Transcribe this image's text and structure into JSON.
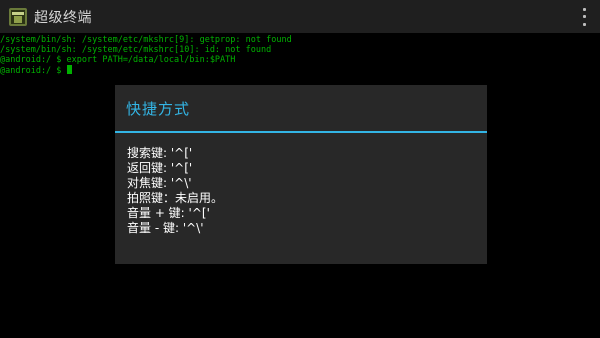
{
  "app": {
    "title": "超级终端",
    "icon": "terminal-app-icon",
    "overflow_icon": "overflow-menu-icon"
  },
  "terminal": {
    "lines": [
      "/system/bin/sh: /system/etc/mkshrc[9]: getprop: not found",
      "/system/bin/sh: /system/etc/mkshrc[10]: id: not found",
      "@android:/ $ export PATH=/data/local/bin:$PATH",
      "@android:/ $ "
    ]
  },
  "dialog": {
    "title": "快捷方式",
    "lines": [
      "搜索键: '^['",
      "返回键: '^['",
      "对焦键: '^\\'",
      "拍照键：未启用。",
      "音量 + 键: '^['",
      "音量 - 键: '^\\'"
    ]
  },
  "colors": {
    "terminal_text": "#00b000",
    "accent": "#33b5e5",
    "action_bar": "#1f1f1f",
    "dialog_bg": "#282828"
  }
}
